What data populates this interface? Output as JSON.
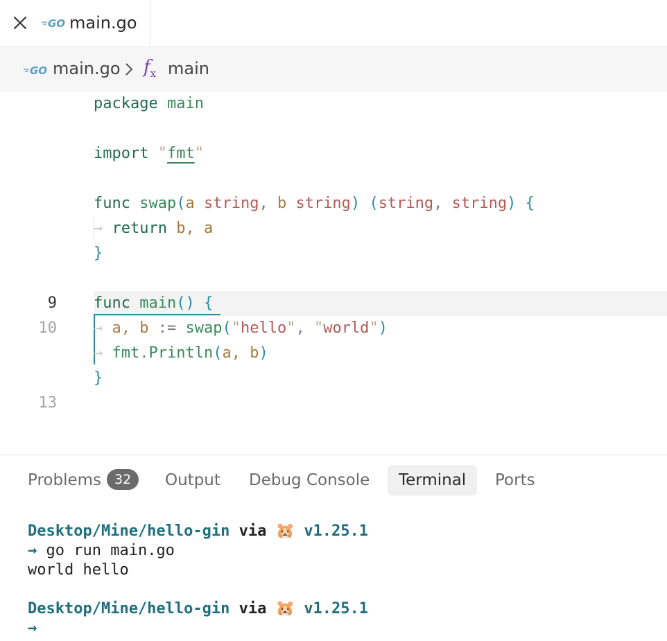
{
  "tab": {
    "title": "main.go",
    "icon": "go-icon"
  },
  "breadcrumb": {
    "file": "main.go",
    "fx": "f",
    "fx_sub": "x",
    "symbol": "main"
  },
  "code": {
    "line1": {
      "kw": "package",
      "name": "main"
    },
    "line3": {
      "kw": "import",
      "q1": "\"",
      "pkg": "fmt",
      "q2": "\""
    },
    "line5": {
      "kw": "func",
      "fn": "swap",
      "p1": "(",
      "a": "a",
      "t1": "string",
      "comma1": ",",
      "b": "b",
      "t2": "string",
      "p2": ")",
      "p3": "(",
      "t3": "string",
      "comma2": ",",
      "t4": "string",
      "p4": ")",
      "brace": "{"
    },
    "line6": {
      "kw": "return",
      "vals": "b, a"
    },
    "line7": {
      "brace": "}"
    },
    "line9": {
      "kw": "func",
      "fn": "main",
      "parens": "()",
      "brace": "{"
    },
    "line10": {
      "lhs": "a, b",
      "op": ":=",
      "fn": "swap",
      "p1": "(",
      "s1": "hello",
      "comma": ",",
      "s2": "world",
      "p2": ")"
    },
    "line11": {
      "pkg": "fmt",
      "dot": ".",
      "fn": "Println",
      "p1": "(",
      "args": "a, b",
      "p2": ")"
    },
    "line12": {
      "brace": "}"
    },
    "visible_line_numbers": {
      "l9": "9",
      "l10": "10",
      "l13": "13"
    }
  },
  "panel": {
    "tabs": [
      {
        "label": "Problems",
        "badge": "32"
      },
      {
        "label": "Output"
      },
      {
        "label": "Debug Console"
      },
      {
        "label": "Terminal"
      },
      {
        "label": "Ports"
      }
    ],
    "active_tab": "Terminal"
  },
  "terminal": {
    "prompt1": {
      "path": "Desktop/Mine/hello-gin",
      "via": "via",
      "emoji": "🐹",
      "version": "v1.25.1"
    },
    "cmd": {
      "arrow": "→",
      "text": "go run main.go"
    },
    "output": "world hello",
    "prompt2": {
      "path": "Desktop/Mine/hello-gin",
      "via": "via",
      "emoji": "🐹",
      "version": "v1.25.1"
    },
    "cursor_arrow": "→"
  },
  "colors": {
    "accent": "#2a8aa5",
    "keyword": "#1f6b4e",
    "string": "#b25a55",
    "terminal_path": "#1f6f7d"
  }
}
